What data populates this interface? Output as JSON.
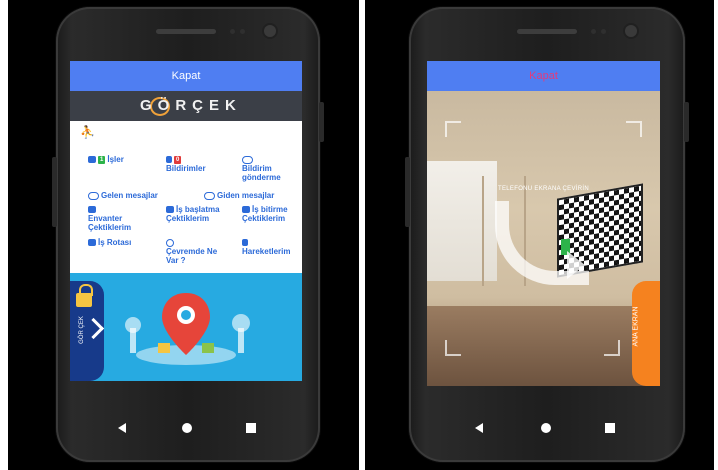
{
  "left_screen": {
    "topbar_label": "Kapat",
    "logo": "GÖRÇEK",
    "menu": [
      {
        "key": "isler",
        "label": "İşler",
        "badge": "1",
        "badge_color": "#2db34a"
      },
      {
        "key": "bildirimler",
        "label": "Bildirimler",
        "badge": "0",
        "badge_color": "#e03b3b"
      },
      {
        "key": "bildirim_gonderme",
        "label": "Bildirim gönderme"
      },
      {
        "key": "gelen",
        "label": "Gelen mesajlar"
      },
      {
        "key": "giden",
        "label": "Giden mesajlar"
      },
      {
        "key": "envanter",
        "label": "Envanter Çektiklerim"
      },
      {
        "key": "is_baslatma",
        "label": "İş başlatma Çektiklerim"
      },
      {
        "key": "is_bitirme",
        "label": "İş bitirme Çektiklerim"
      },
      {
        "key": "is_rotasi",
        "label": "İş Rotası"
      },
      {
        "key": "cevremde",
        "label": "Çevremde Ne Var ?"
      },
      {
        "key": "hareketlerim",
        "label": "Hareketlerim"
      }
    ],
    "side_tab_label": "GÖR ÇEK"
  },
  "right_screen": {
    "topbar_label": "Kapat",
    "overlay_text": "TELEFONU EKRANA ÇEVİRİN",
    "side_button_label": "ANA EKRAN"
  },
  "colors": {
    "topbar": "#4f7ef2",
    "hero": "#27aae1",
    "side_tab": "#173a8a",
    "orange": "#f5821f"
  }
}
